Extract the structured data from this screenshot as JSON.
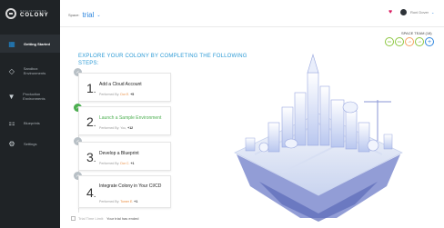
{
  "app": {
    "brand_top": "QUALISYSTEMS",
    "brand_name": "COLONY"
  },
  "sidebar": {
    "items": [
      {
        "label": "Getting Started",
        "icon": "getting-started-icon",
        "active": true
      },
      {
        "label": "Sandbox Environments",
        "icon": "sandbox-icon",
        "active": false
      },
      {
        "label": "Production Environments",
        "icon": "production-icon",
        "active": false
      },
      {
        "label": "Blueprints",
        "icon": "blueprints-icon",
        "active": false
      },
      {
        "label": "Settings",
        "icon": "settings-icon",
        "active": false
      }
    ]
  },
  "header": {
    "space_label": "Space:",
    "space_value": "trial",
    "user_name": "Roni Dover",
    "team_label": "SPACE TEAM (18)",
    "team_members": [
      "RD",
      "DG",
      "+8",
      "+9"
    ]
  },
  "main": {
    "heading": "EXPLORE YOUR COLONY BY COMPLETING THE FOLLOWING STEPS:",
    "steps": [
      {
        "number": "1",
        "title": "Add a Cloud Account",
        "performed_label": "Performed By:",
        "performed_by": "Dor E.",
        "points": "+5",
        "done": false
      },
      {
        "number": "2",
        "title": "Launch a Sample Environment",
        "performed_label": "Performed By:",
        "performed_by": "You,",
        "points": "+12",
        "done": true
      },
      {
        "number": "3",
        "title": "Develop a Blueprint",
        "performed_label": "Performed By:",
        "performed_by": "Dor C.",
        "points": "+1",
        "done": false
      },
      {
        "number": "4",
        "title": "Integrate Colony in Your CI/CD",
        "performed_label": "Performed By:",
        "performed_by": "Tomer E.",
        "points": "+1",
        "done": false
      }
    ],
    "trial_label": "Trial Time Limit:",
    "trial_value": "Your trial has ended"
  },
  "colors": {
    "accent": "#2e86de",
    "done": "#4caf50",
    "sidebar_bg": "#1f2326",
    "heart": "#d81b60"
  }
}
